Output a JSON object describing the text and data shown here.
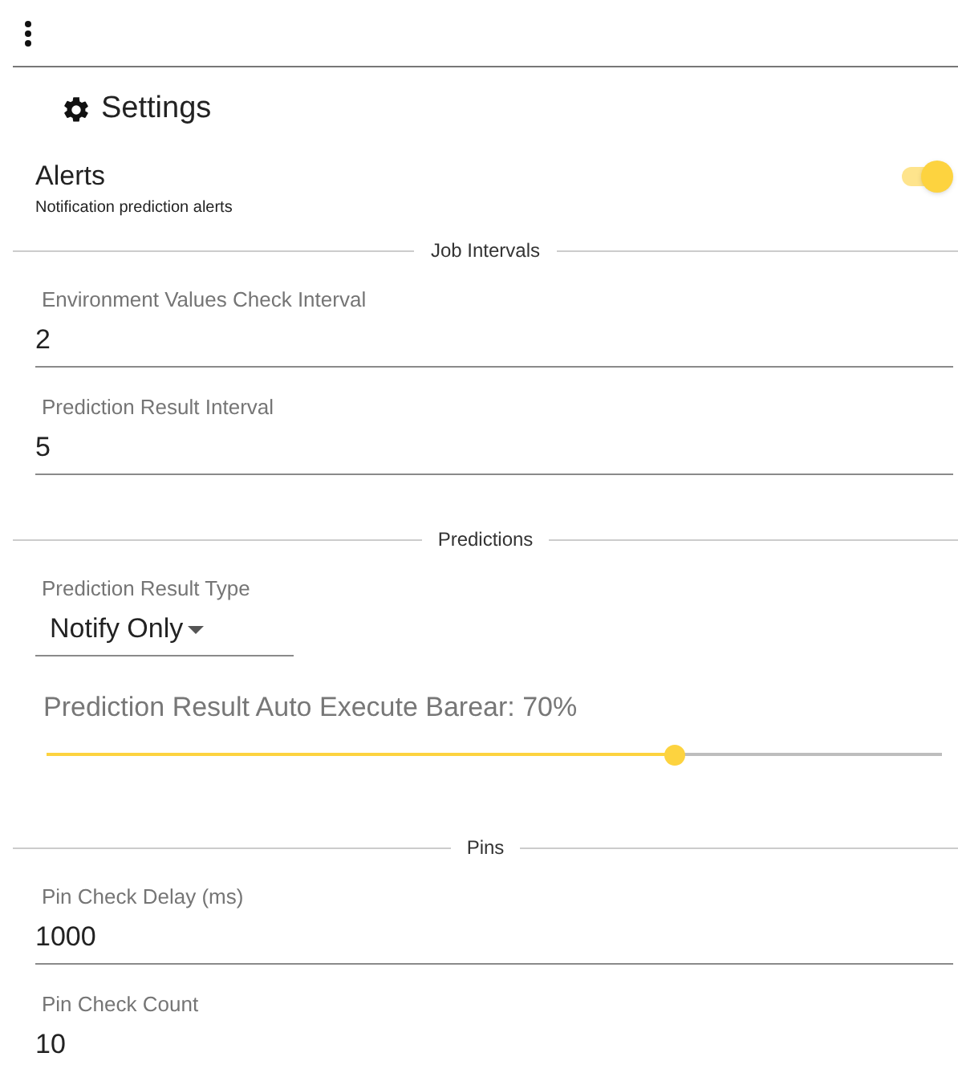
{
  "header": {
    "title": "Settings"
  },
  "alerts": {
    "title": "Alerts",
    "subtitle": "Notification prediction alerts",
    "on": true
  },
  "sections": [
    {
      "title": "Job Intervals",
      "items": [
        {
          "kind": "text",
          "label": "Environment Values Check Interval",
          "value": "2"
        },
        {
          "kind": "text",
          "label": "Prediction Result Interval",
          "value": "5"
        }
      ]
    },
    {
      "title": "Predictions",
      "items": [
        {
          "kind": "select",
          "label": "Prediction Result Type",
          "value": "Notify Only"
        },
        {
          "kind": "slider",
          "label": "Prediction Result Auto Execute Barear: 70%",
          "level": 0.7
        }
      ]
    },
    {
      "title": "Pins",
      "items": [
        {
          "kind": "text",
          "label": "Pin Check Delay (ms)",
          "value": "1000"
        },
        {
          "kind": "text",
          "label": "Pin Check Count",
          "value": "10"
        }
      ]
    }
  ]
}
